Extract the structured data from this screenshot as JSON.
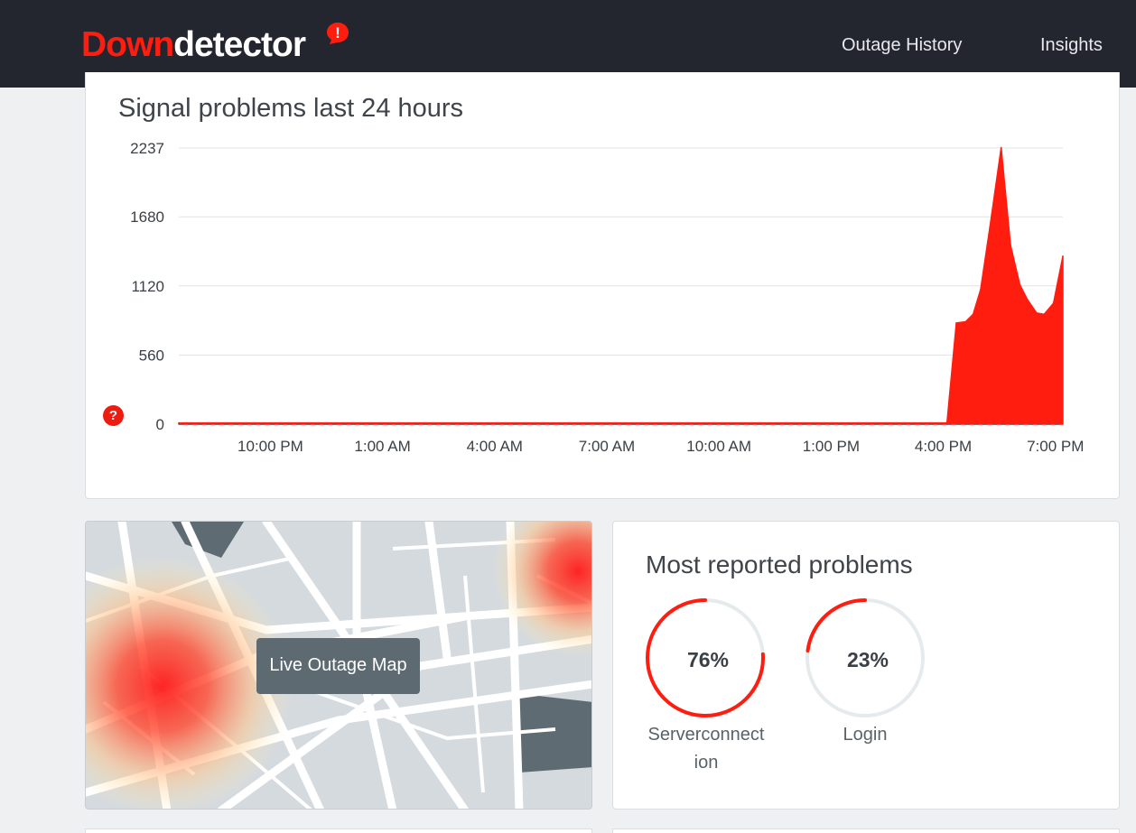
{
  "header": {
    "logo_part1": "Down",
    "logo_part2": "detector",
    "logo_mark": "!",
    "nav": [
      {
        "label": "Outage History"
      },
      {
        "label": "Insights"
      }
    ]
  },
  "chart_panel": {
    "title": "Signal problems last 24 hours",
    "help_badge": "?"
  },
  "chart_data": {
    "type": "area",
    "title": "Signal problems last 24 hours",
    "xlabel": "",
    "ylabel": "",
    "y_ticks": [
      0,
      560,
      1120,
      1680,
      2237
    ],
    "ylim": [
      0,
      2237
    ],
    "x_ticks": [
      "10:00 PM",
      "1:00 AM",
      "4:00 AM",
      "7:00 AM",
      "10:00 AM",
      "1:00 PM",
      "4:00 PM",
      "7:00 PM"
    ],
    "x_hours": [
      0,
      3,
      6,
      9,
      12,
      15,
      18,
      21
    ],
    "xlim_hours": [
      -2.45,
      21.2
    ],
    "grid": true,
    "baseline_dashed": true,
    "series": [
      {
        "color": "#ff1d10",
        "x_hours": [
          -2.45,
          18.1,
          18.35,
          18.6,
          18.8,
          19.0,
          19.25,
          19.55,
          19.8,
          20.05,
          20.25,
          20.5,
          20.7,
          20.95,
          21.2
        ],
        "values": [
          10,
          10,
          820,
          830,
          890,
          1090,
          1600,
          2240,
          1450,
          1130,
          1010,
          900,
          890,
          980,
          1360
        ]
      }
    ]
  },
  "map_panel": {
    "button_label": "Live Outage Map"
  },
  "problems_panel": {
    "title": "Most reported problems",
    "items": [
      {
        "percent_text": "76%",
        "percent": 76,
        "label_line1": "Serverconnect",
        "label_line2": "ion"
      },
      {
        "percent_text": "23%",
        "percent": 23,
        "label_line1": "Login",
        "label_line2": ""
      }
    ]
  },
  "colors": {
    "accent": "#ff1d10",
    "header_bg": "#23252f",
    "ring_track": "#e5ebed"
  }
}
